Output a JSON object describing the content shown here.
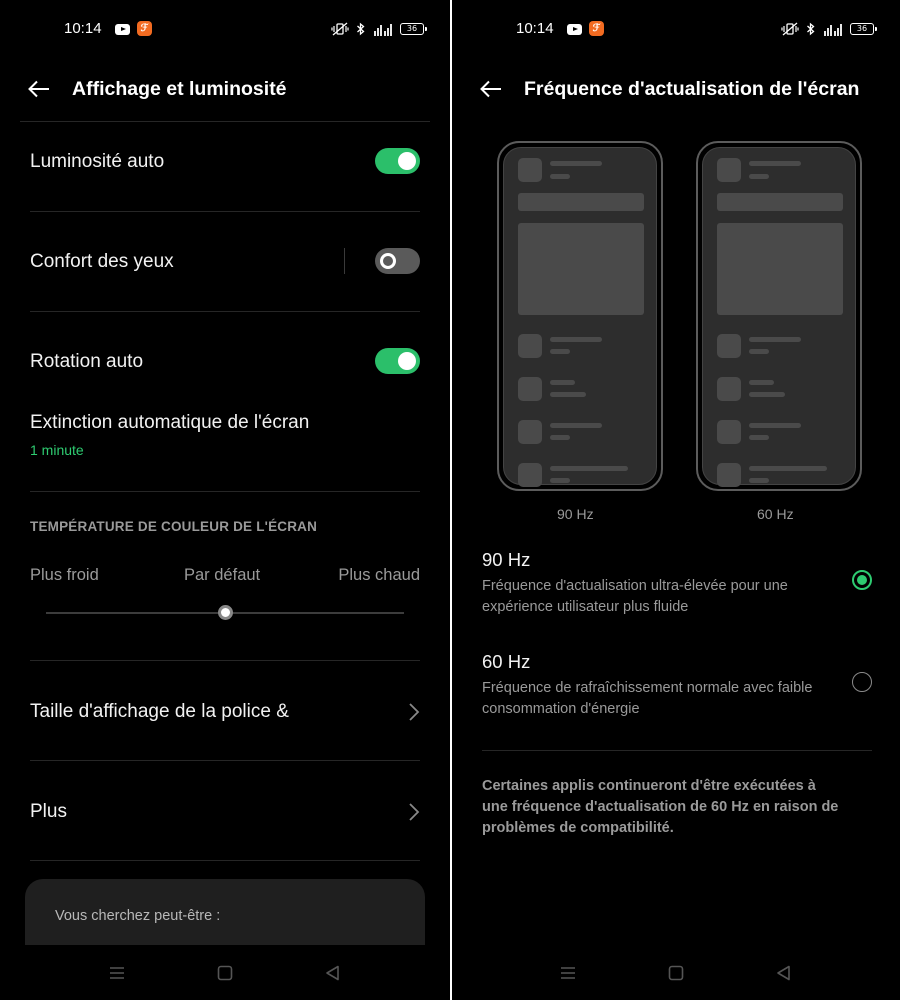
{
  "status_bar": {
    "time": "10:14",
    "battery": "36"
  },
  "left": {
    "title": "Affichage et luminosité",
    "auto_brightness": {
      "label": "Luminosité auto",
      "enabled": true
    },
    "eye_comfort": {
      "label": "Confort des yeux",
      "enabled": false
    },
    "auto_rotate": {
      "label": "Rotation auto",
      "enabled": true
    },
    "screen_timeout": {
      "label": "Extinction automatique de l'écran",
      "value": "1 minute"
    },
    "color_temperature": {
      "section_title": "TEMPÉRATURE DE COULEUR DE L'ÉCRAN",
      "cooler": "Plus froid",
      "default": "Par défaut",
      "warmer": "Plus chaud",
      "level": 0.5
    },
    "font_size": {
      "label": "Taille d'affichage de la police &"
    },
    "more": {
      "label": "Plus"
    },
    "suggestion": {
      "text": "Vous cherchez peut-être :"
    }
  },
  "right": {
    "title": "Fréquence d'actualisation de l'écran",
    "previews": [
      {
        "caption": "90 Hz"
      },
      {
        "caption": "60 Hz"
      }
    ],
    "options": [
      {
        "title": "90 Hz",
        "description": "Fréquence d'actualisation ultra-élevée pour une expérience utilisateur plus fluide",
        "selected": true
      },
      {
        "title": "60 Hz",
        "description": "Fréquence de rafraîchissement normale avec faible consommation d'énergie",
        "selected": false
      }
    ],
    "note": "Certaines applis continueront d'être exécutées à une fréquence d'actualisation de 60 Hz en raison de problèmes de compatibilité."
  },
  "colors": {
    "accent": "#2ecc71",
    "toggle_on": "#2bbf6a",
    "toggle_off": "#5a5a5a",
    "background": "#000000"
  },
  "icons": [
    "back-arrow-icon",
    "chevron-right-icon",
    "youtube-icon",
    "bluetooth-icon",
    "vibrate-icon",
    "signal-icon",
    "battery-icon",
    "recents-icon",
    "home-icon",
    "back-nav-icon"
  ]
}
